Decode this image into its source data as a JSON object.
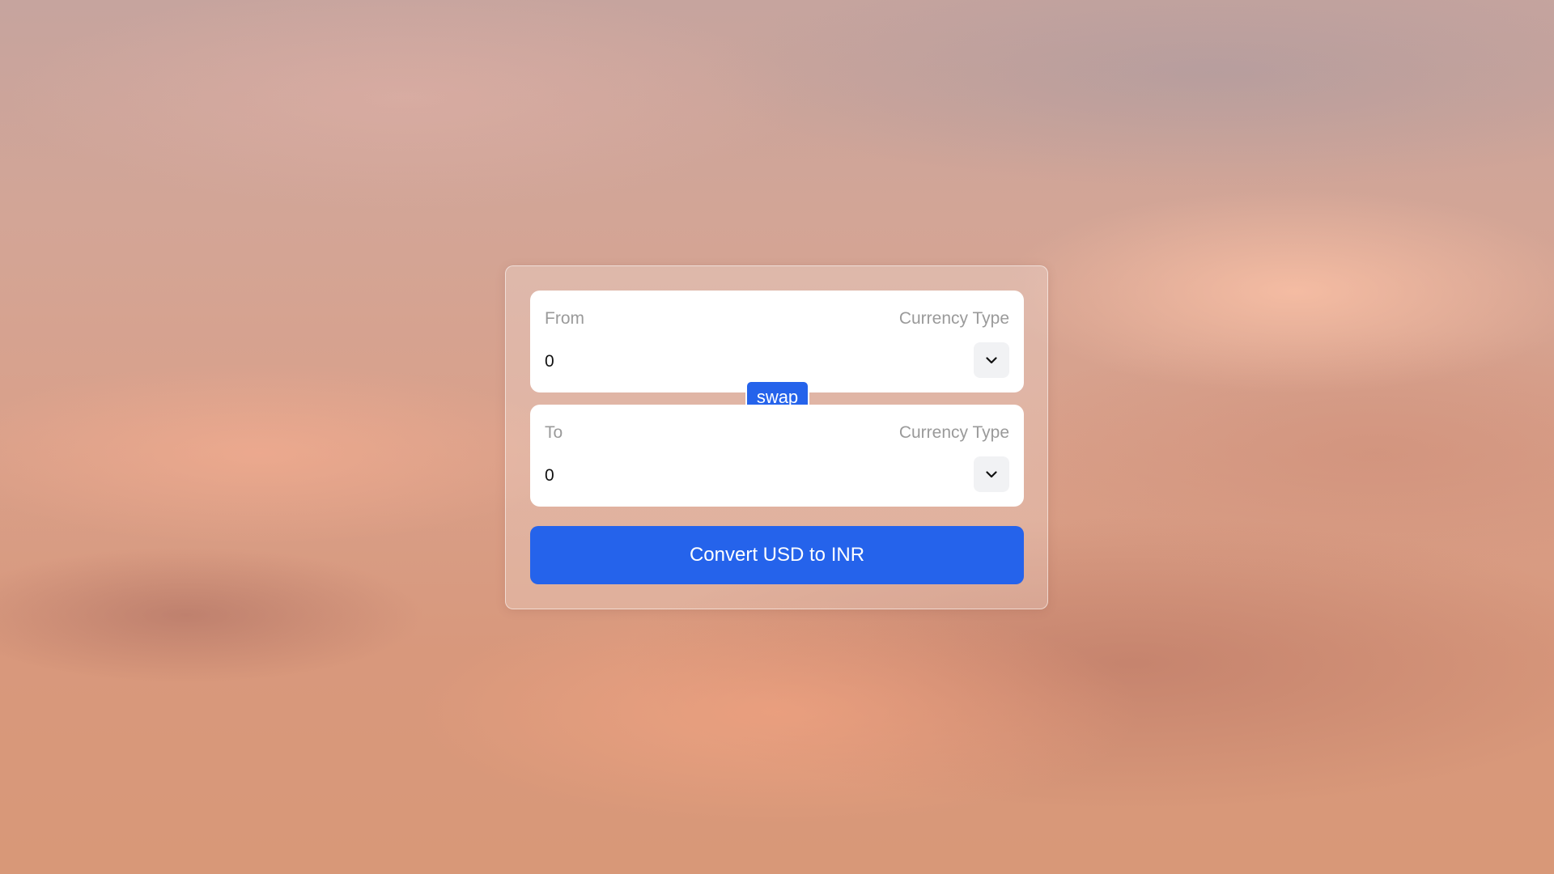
{
  "colors": {
    "accent": "#2563eb",
    "label": "#9a9a9a",
    "field_bg": "#ffffff"
  },
  "from": {
    "label": "From",
    "currency_type_label": "Currency Type",
    "amount": "0",
    "select_icon": "chevron-down-icon"
  },
  "swap": {
    "label": "swap"
  },
  "to": {
    "label": "To",
    "currency_type_label": "Currency Type",
    "amount": "0",
    "select_icon": "chevron-down-icon"
  },
  "convert": {
    "label": "Convert USD to INR"
  }
}
